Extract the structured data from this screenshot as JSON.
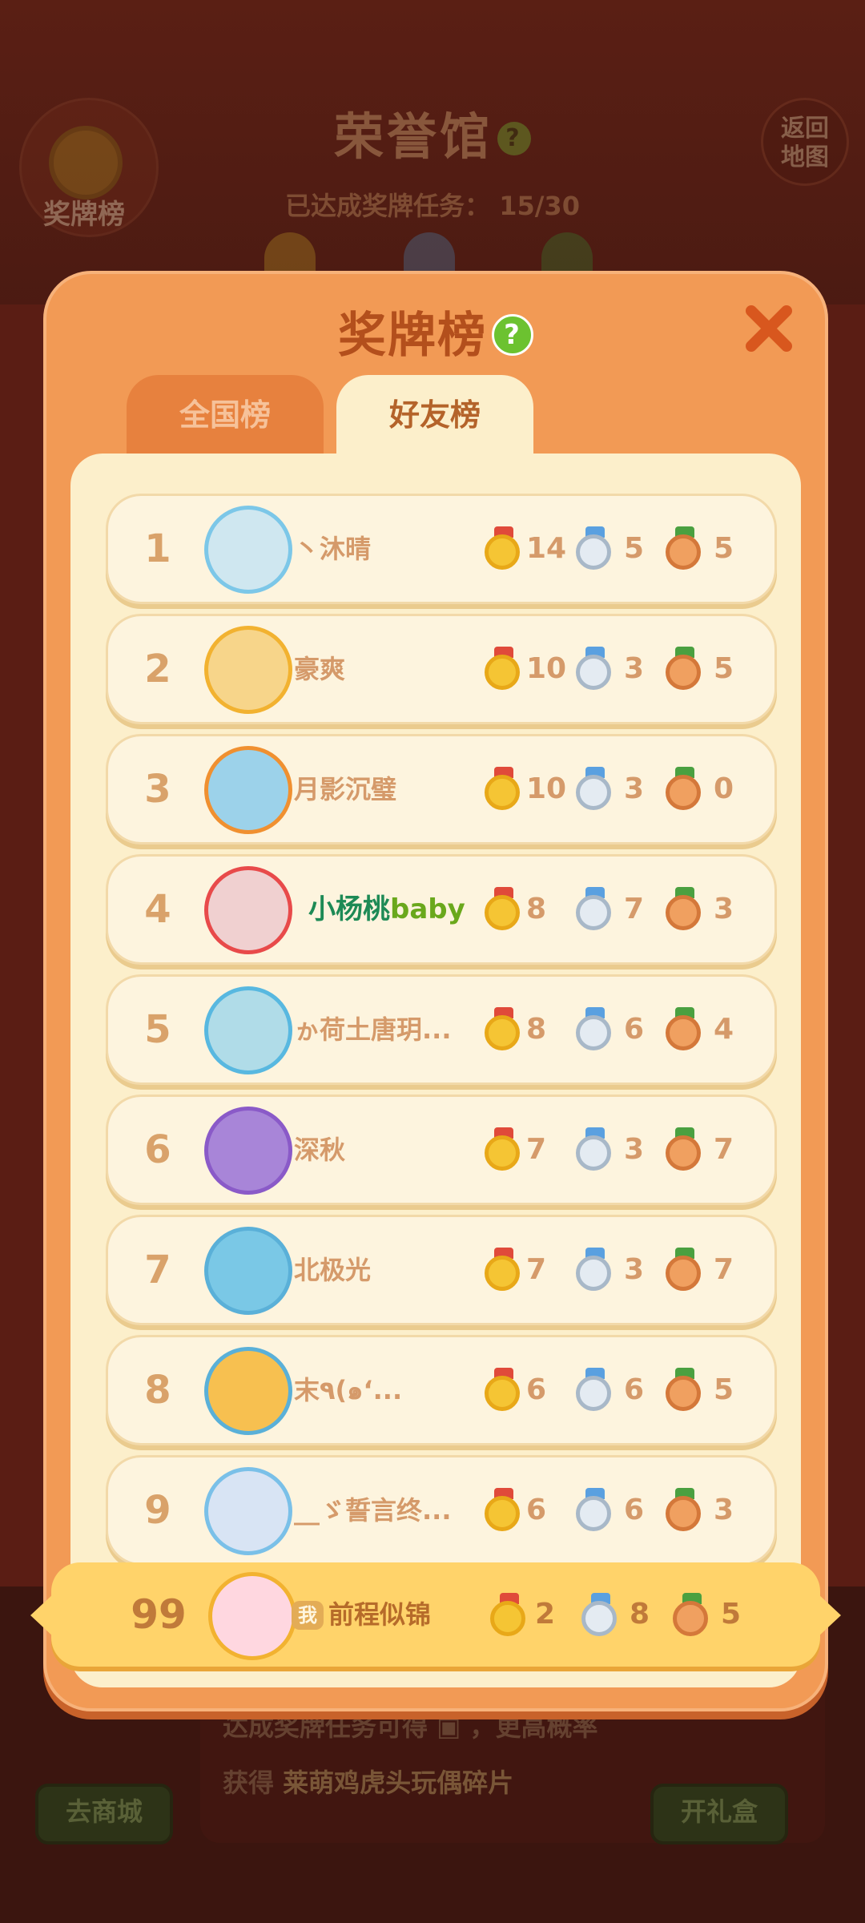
{
  "background": {
    "title": "荣誉馆",
    "subtitle_label": "已达成奖牌任务：",
    "subtitle_value": "15/30",
    "medal_board_label": "奖牌榜",
    "back_map_label_1": "返回",
    "back_map_label_2": "地图",
    "bottom_text_1": "达成奖牌任务可得",
    "bottom_text_1b": "，更高概率",
    "bottom_text_2": "获得",
    "bottom_text_2b": "莱萌鸡虎头玩偶碎片",
    "shop_button": "去商城",
    "gift_button": "开礼盒"
  },
  "modal": {
    "title": "奖牌榜",
    "help": "?",
    "tabs": [
      {
        "label": "全国榜",
        "active": false
      },
      {
        "label": "好友榜",
        "active": true
      }
    ]
  },
  "leaderboard": [
    {
      "rank": "1",
      "name": "丶沐晴",
      "gold": "14",
      "silver": "5",
      "bronze": "5"
    },
    {
      "rank": "2",
      "name": "豪爽",
      "gold": "10",
      "silver": "3",
      "bronze": "5"
    },
    {
      "rank": "3",
      "name": "月影沉璧",
      "gold": "10",
      "silver": "3",
      "bronze": "0"
    },
    {
      "rank": "4",
      "name_main": "小杨桃",
      "name_suffix": "baby",
      "gold": "8",
      "silver": "7",
      "bronze": "3"
    },
    {
      "rank": "5",
      "name": "ゕ荷土唐玥...",
      "gold": "8",
      "silver": "6",
      "bronze": "4"
    },
    {
      "rank": "6",
      "name": "深秋",
      "gold": "7",
      "silver": "3",
      "bronze": "7"
    },
    {
      "rank": "7",
      "name": "北极光",
      "gold": "7",
      "silver": "3",
      "bronze": "7"
    },
    {
      "rank": "8",
      "name": "末٩(๑ʻ...",
      "gold": "6",
      "silver": "6",
      "bronze": "5"
    },
    {
      "rank": "9",
      "name": "__ゞ誓言终...",
      "gold": "6",
      "silver": "6",
      "bronze": "3"
    }
  ],
  "self_row": {
    "rank": "99",
    "badge": "我",
    "name": "前程似锦",
    "gold": "2",
    "silver": "8",
    "bronze": "5"
  },
  "colors": {
    "accent": "#f29a55",
    "title": "#b34f1c",
    "panel": "#fcefcb"
  }
}
